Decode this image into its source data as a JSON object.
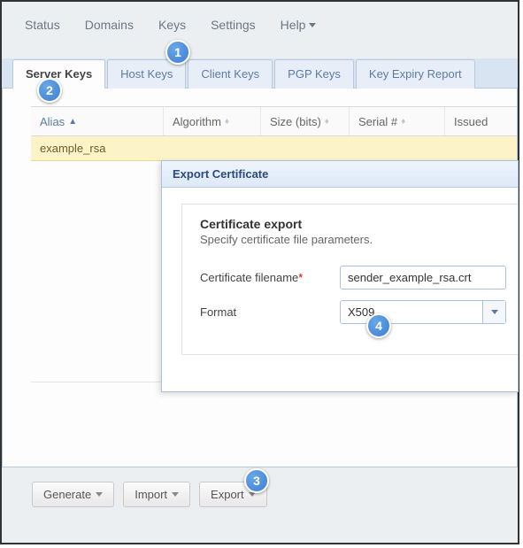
{
  "menu": {
    "status": "Status",
    "domains": "Domains",
    "keys": "Keys",
    "settings": "Settings",
    "help": "Help"
  },
  "tabs": {
    "server_keys": "Server Keys",
    "host_keys": "Host Keys",
    "client_keys": "Client Keys",
    "pgp_keys": "PGP Keys",
    "key_expiry": "Key Expiry Report"
  },
  "table": {
    "headers": {
      "alias": "Alias",
      "algorithm": "Algorithm",
      "size": "Size (bits)",
      "serial": "Serial #",
      "issued": "Issued"
    },
    "rows": [
      {
        "alias": "example_rsa"
      }
    ]
  },
  "dialog": {
    "title": "Export Certificate",
    "section_title": "Certificate export",
    "section_sub": "Specify certificate file parameters.",
    "filename_label": "Certificate filename",
    "filename_value": "sender_example_rsa.crt",
    "format_label": "Format",
    "format_value": "X509"
  },
  "buttons": {
    "generate": "Generate",
    "import": "Import",
    "export": "Export"
  },
  "callouts": {
    "c1": "1",
    "c2": "2",
    "c3": "3",
    "c4": "4"
  }
}
